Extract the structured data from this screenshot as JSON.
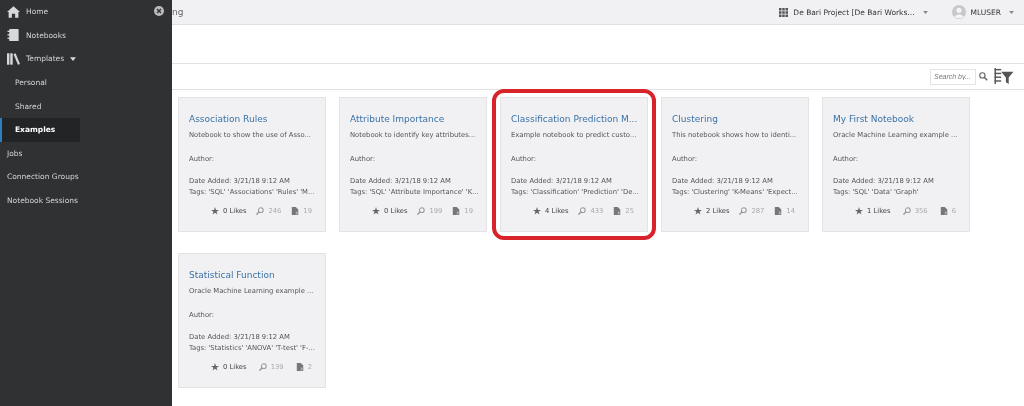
{
  "sidebar": {
    "items": [
      {
        "label": "Home",
        "selected": false
      },
      {
        "label": "Notebooks",
        "selected": false
      },
      {
        "label": "Templates",
        "selected": false,
        "expanded": true,
        "children": [
          {
            "label": "Personal",
            "selected": false
          },
          {
            "label": "Shared",
            "selected": false
          },
          {
            "label": "Examples",
            "selected": true
          }
        ]
      },
      {
        "label": "Jobs",
        "selected": false
      },
      {
        "label": "Connection Groups",
        "selected": false
      },
      {
        "label": "Notebook Sessions",
        "selected": false
      }
    ]
  },
  "header": {
    "breadcrumb": "ng",
    "project": "De Bari Project [De Bari Works...",
    "user": "MLUSER"
  },
  "toolbar": {
    "search": {
      "placeholder": "Search by..."
    }
  },
  "cards": [
    {
      "title": "Association Rules",
      "description": "Notebook to show the use of Asso...",
      "author": "Author:",
      "date": "Date Added: 3/21/18 9:12 AM",
      "tags": "Tags: 'SQL' 'Associations' 'Rules' 'M...",
      "likes": "0 Likes",
      "views": "246",
      "copies": "19",
      "highlighted": false
    },
    {
      "title": "Attribute Importance",
      "description": "Notebook to identify key attributes...",
      "author": "Author:",
      "date": "Date Added: 3/21/18 9:12 AM",
      "tags": "Tags: 'SQL' 'Attribute Importance' 'K...",
      "likes": "0 Likes",
      "views": "199",
      "copies": "19",
      "highlighted": false
    },
    {
      "title": "Classification Prediction M...",
      "description": "Example notebook to predict custo...",
      "author": "Author:",
      "date": "Date Added: 3/21/18 9:12 AM",
      "tags": "Tags: 'Classification' 'Prediction' 'De...",
      "likes": "4 Likes",
      "views": "433",
      "copies": "25",
      "highlighted": true
    },
    {
      "title": "Clustering",
      "description": "This notebook shows how to identi...",
      "author": "Author:",
      "date": "Date Added: 3/21/18 9:12 AM",
      "tags": "Tags: 'Clustering' 'K-Means' 'Expect...",
      "likes": "2 Likes",
      "views": "287",
      "copies": "14",
      "highlighted": false
    },
    {
      "title": "My First Notebook",
      "description": "Oracle Machine Learning example ...",
      "author": "Author:",
      "date": "Date Added: 3/21/18 9:12 AM",
      "tags": "Tags: 'SQL' 'Data' 'Graph'",
      "likes": "1 Likes",
      "views": "356",
      "copies": "6",
      "highlighted": false
    },
    {
      "title": "Statistical Function",
      "description": "Oracle Machine Learning example ...",
      "author": "Author:",
      "date": "Date Added: 3/21/18 9:12 AM",
      "tags": "Tags: 'Statistics' 'ANOVA' 'T-test' 'F-...",
      "likes": "0 Likes",
      "views": "139",
      "copies": "2",
      "highlighted": false
    }
  ]
}
